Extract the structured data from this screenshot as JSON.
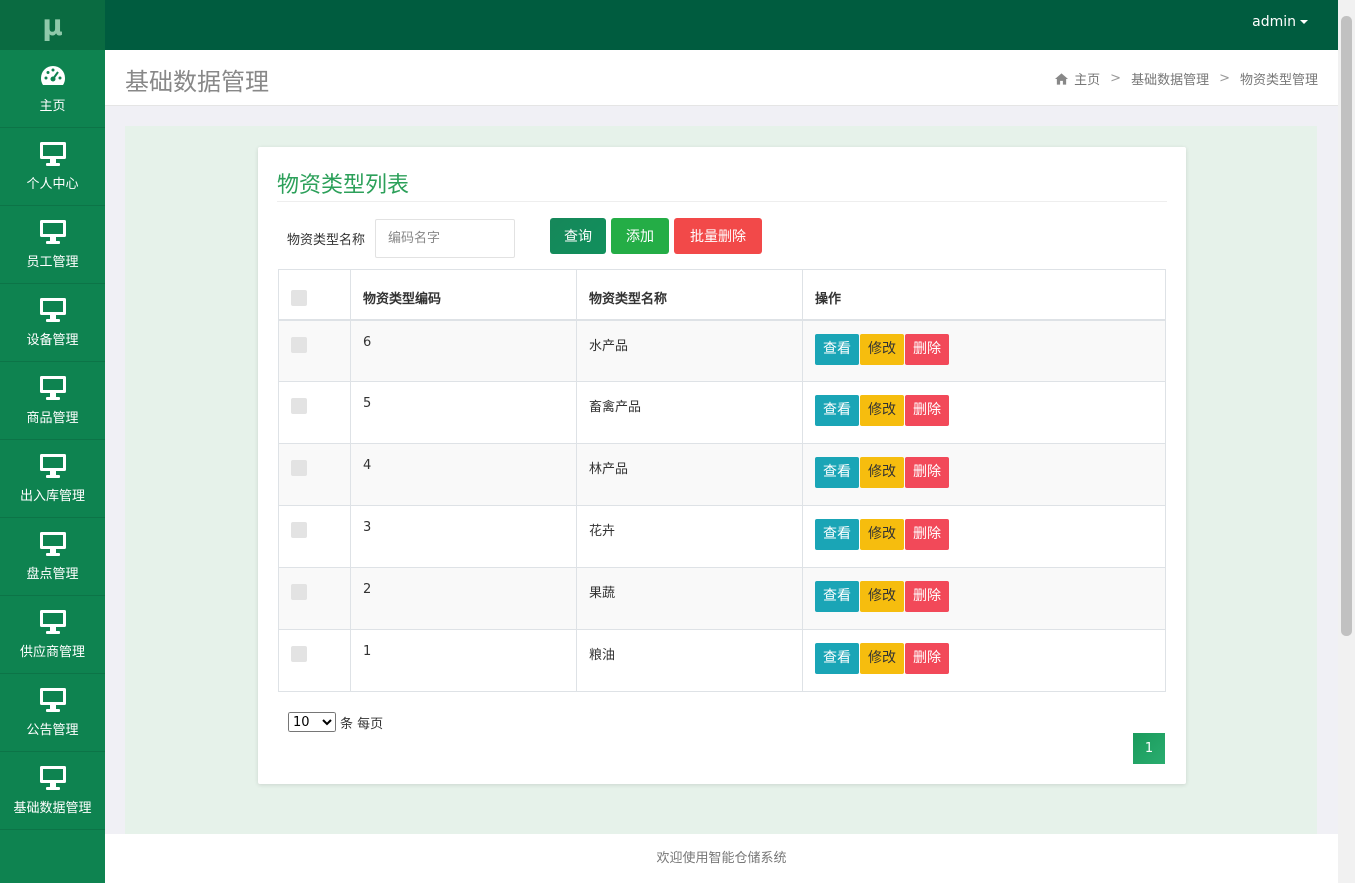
{
  "app": {
    "logo_text": "μ"
  },
  "topbar": {
    "user": "admin"
  },
  "sidebar": {
    "items": [
      {
        "label": "主页",
        "icon": "dashboard-icon"
      },
      {
        "label": "个人中心",
        "icon": "monitor-icon"
      },
      {
        "label": "员工管理",
        "icon": "monitor-icon"
      },
      {
        "label": "设备管理",
        "icon": "monitor-icon"
      },
      {
        "label": "商品管理",
        "icon": "monitor-icon"
      },
      {
        "label": "出入库管理",
        "icon": "monitor-icon"
      },
      {
        "label": "盘点管理",
        "icon": "monitor-icon"
      },
      {
        "label": "供应商管理",
        "icon": "monitor-icon"
      },
      {
        "label": "公告管理",
        "icon": "monitor-icon"
      },
      {
        "label": "基础数据管理",
        "icon": "monitor-icon"
      }
    ]
  },
  "header": {
    "title": "基础数据管理",
    "breadcrumb": [
      "主页",
      "基础数据管理",
      "物资类型管理"
    ]
  },
  "card": {
    "title": "物资类型列表",
    "search_label": "物资类型名称",
    "search_placeholder": "编码名字",
    "btn_query": "查询",
    "btn_add": "添加",
    "btn_batch_delete": "批量删除"
  },
  "table": {
    "headers": [
      "物资类型编码",
      "物资类型名称",
      "操作"
    ],
    "ops": {
      "view": "查看",
      "edit": "修改",
      "delete": "删除"
    },
    "rows": [
      {
        "code": "6",
        "name": "水产品"
      },
      {
        "code": "5",
        "name": "畜禽产品"
      },
      {
        "code": "4",
        "name": "林产品"
      },
      {
        "code": "3",
        "name": "花卉"
      },
      {
        "code": "2",
        "name": "果蔬"
      },
      {
        "code": "1",
        "name": "粮油"
      }
    ]
  },
  "pager": {
    "page_size": "10",
    "page_size_suffix": "条 每页",
    "current_page": "1"
  },
  "footer": {
    "text": "欢迎使用智能仓储系统"
  },
  "colors": {
    "sidebar": "#0e8350",
    "topbar": "#005c3f",
    "accent": "#2ca05a",
    "view": "#1aa5b6",
    "edit": "#f6bd0e",
    "delete": "#f24959"
  }
}
